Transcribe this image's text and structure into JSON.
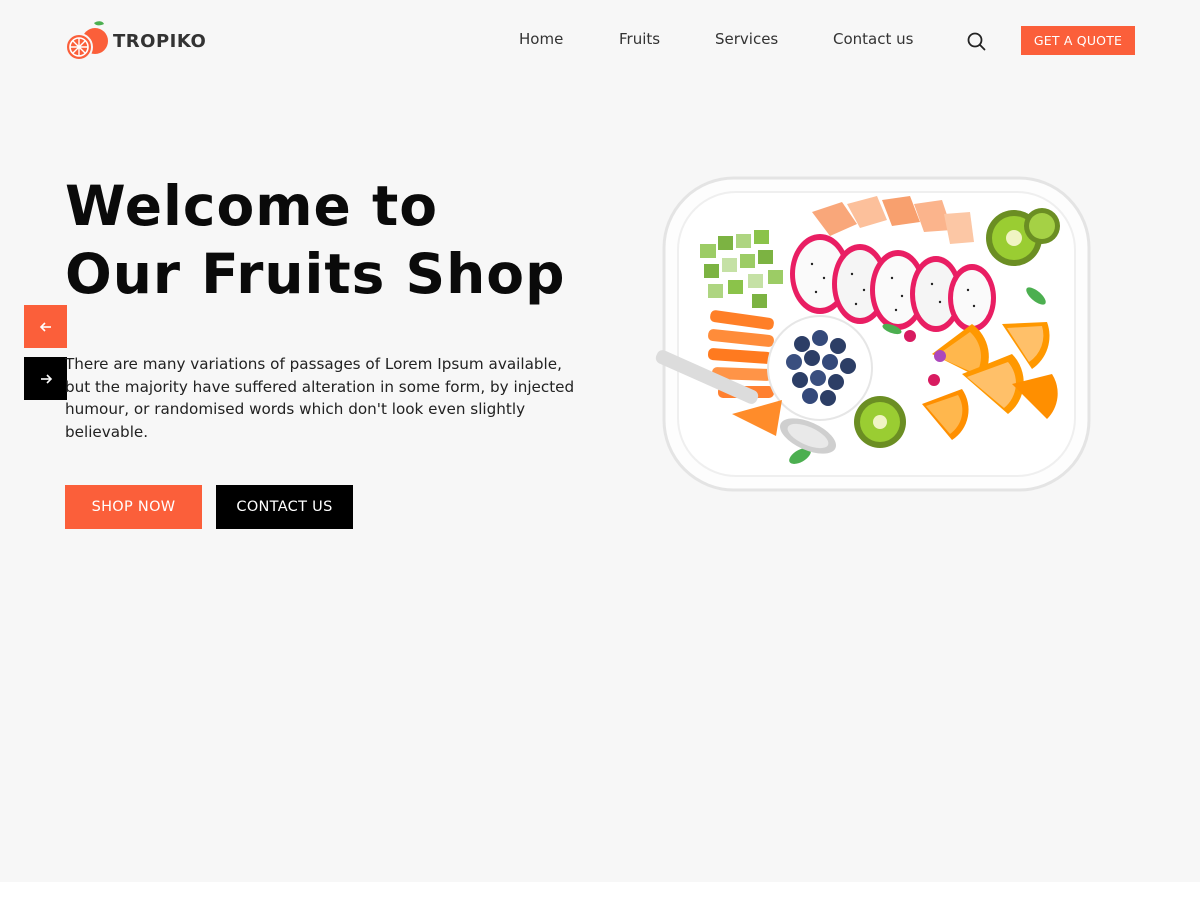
{
  "brand": {
    "name": "TROPIKO",
    "logo_icon": "orange-slice-icon"
  },
  "nav": {
    "items": [
      {
        "label": "Home"
      },
      {
        "label": "Fruits"
      },
      {
        "label": "Services"
      },
      {
        "label": "Contact us"
      }
    ],
    "search_icon": "search-icon",
    "quote_label": "GET A QUOTE"
  },
  "hero": {
    "title_line1": "Welcome to",
    "title_line2": "Our Fruits Shop",
    "description": "There are many variations of passages of Lorem Ipsum available, but the majority have suffered alteration in some form, by injected humour, or randomised words which don't look even slightly believable.",
    "shop_label": "SHOP NOW",
    "contact_label": "CONTACT US",
    "image": "fruit-platter-image"
  },
  "slider": {
    "prev_icon": "arrow-left-icon",
    "next_icon": "arrow-right-icon"
  },
  "colors": {
    "accent": "#fb5f3a",
    "dark": "#000000",
    "background": "#f7f7f7"
  }
}
